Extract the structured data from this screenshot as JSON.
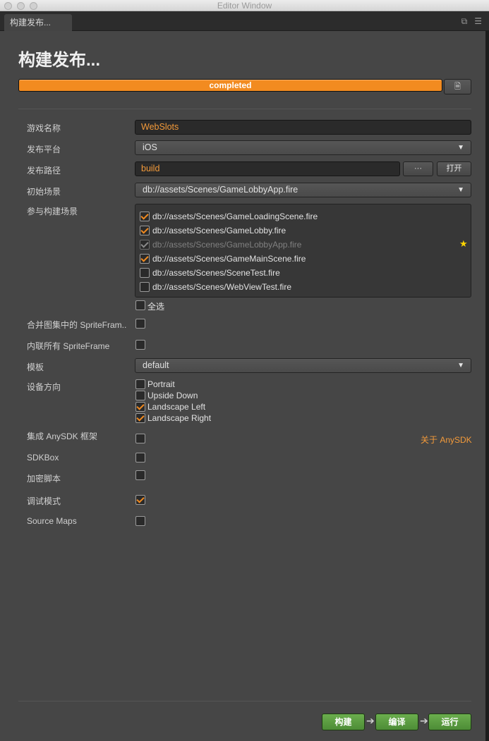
{
  "window": {
    "title": "Editor Window"
  },
  "tab": {
    "label": "构建发布..."
  },
  "page": {
    "title": "构建发布..."
  },
  "progress": {
    "label": "completed",
    "value": 1.0
  },
  "fields": {
    "game_name": {
      "label": "游戏名称",
      "value": "WebSlots"
    },
    "platform": {
      "label": "发布平台",
      "value": "iOS"
    },
    "build_path": {
      "label": "发布路径",
      "value": "build",
      "browse_label": "···",
      "open_label": "打开"
    },
    "start_scene": {
      "label": "初始场景",
      "value": "db://assets/Scenes/GameLobbyApp.fire"
    },
    "scenes_label": "参与构建场景",
    "scenes": [
      {
        "path": "db://assets/Scenes/GameLoadingScene.fire",
        "checked": true,
        "disabled": false
      },
      {
        "path": "db://assets/Scenes/GameLobby.fire",
        "checked": true,
        "disabled": false
      },
      {
        "path": "db://assets/Scenes/GameLobbyApp.fire",
        "checked": true,
        "disabled": true
      },
      {
        "path": "db://assets/Scenes/GameMainScene.fire",
        "checked": true,
        "disabled": false
      },
      {
        "path": "db://assets/Scenes/SceneTest.fire",
        "checked": false,
        "disabled": false
      },
      {
        "path": "db://assets/Scenes/WebViewTest.fire",
        "checked": false,
        "disabled": false
      }
    ],
    "select_all": {
      "label": "全选",
      "checked": false
    },
    "merge_spriteframe": {
      "label": "合并图集中的 SpriteFram..",
      "checked": false
    },
    "inline_spriteframe": {
      "label": "内联所有 SpriteFrame",
      "checked": false
    },
    "template": {
      "label": "模板",
      "value": "default"
    },
    "orientation": {
      "label": "设备方向",
      "options": [
        {
          "label": "Portrait",
          "checked": false
        },
        {
          "label": "Upside Down",
          "checked": false
        },
        {
          "label": "Landscape Left",
          "checked": true
        },
        {
          "label": "Landscape Right",
          "checked": true
        }
      ]
    },
    "anysdk": {
      "label": "集成 AnySDK 框架",
      "checked": false,
      "link": "关于 AnySDK"
    },
    "sdkbox": {
      "label": "SDKBox",
      "checked": false
    },
    "encrypt": {
      "label": "加密脚本",
      "checked": false
    },
    "debug": {
      "label": "调试模式",
      "checked": true
    },
    "sourcemaps": {
      "label": "Source Maps",
      "checked": false
    }
  },
  "actions": {
    "build": "构建",
    "compile": "编译",
    "run": "运行",
    "arrow": "➔"
  },
  "colors": {
    "accent": "#f28b20",
    "button_green": "#5a9c40",
    "panel": "#464646"
  },
  "icons": {
    "star": "★"
  }
}
